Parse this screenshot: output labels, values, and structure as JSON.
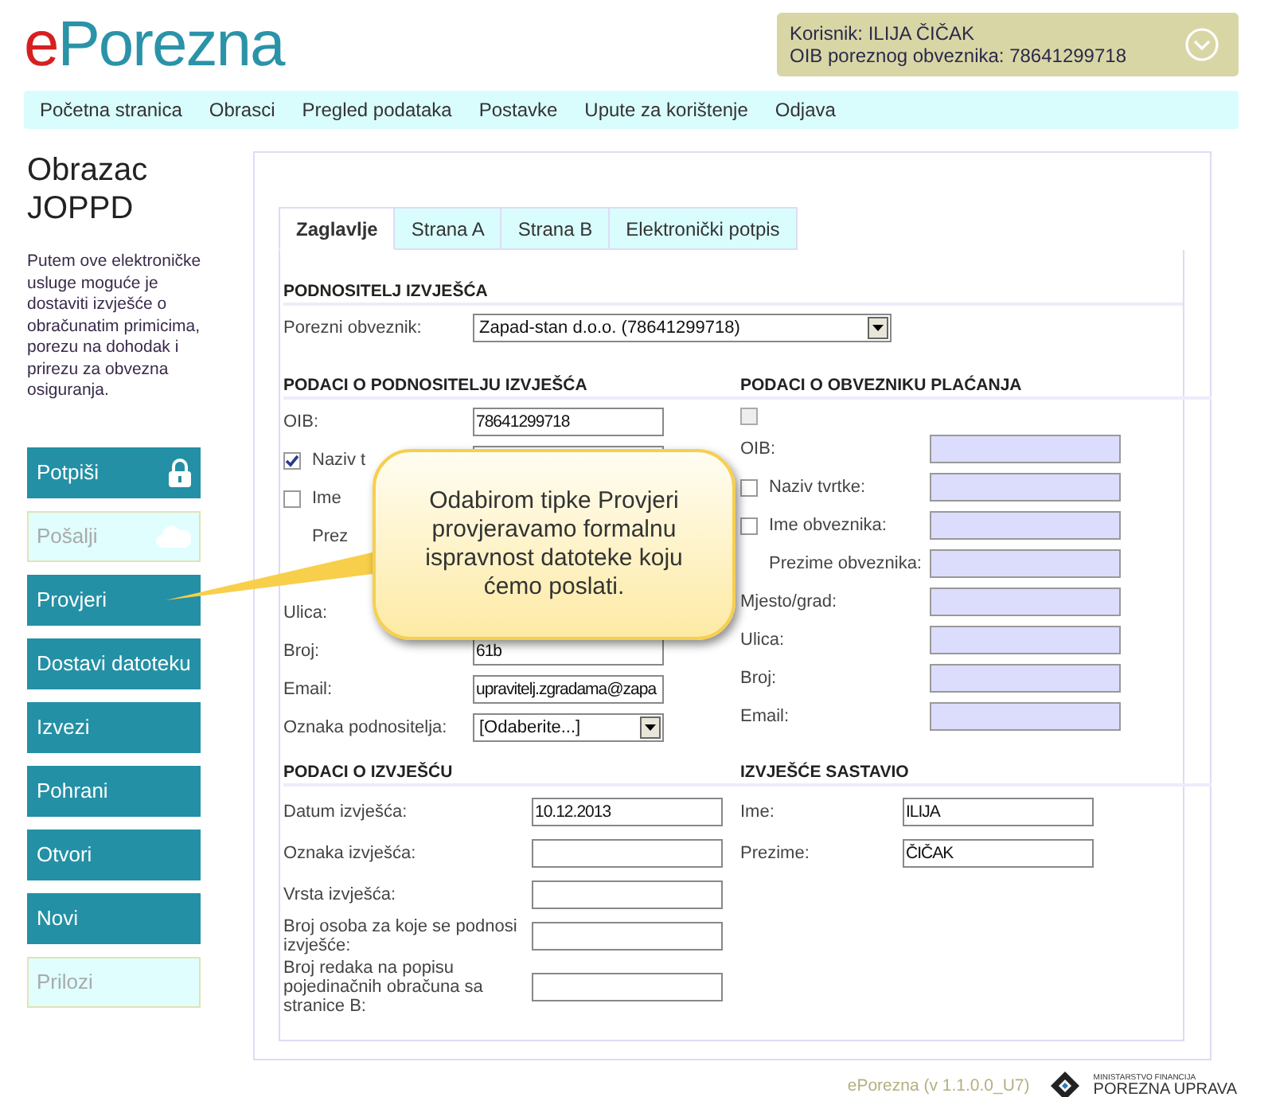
{
  "logo": {
    "prefix": "e",
    "name": "Porezna"
  },
  "user": {
    "line1": "Korisnik: ILIJA ČIČAK",
    "line2": "OIB poreznog obveznika: 78641299718"
  },
  "nav": [
    "Početna stranica",
    "Obrasci",
    "Pregled podataka",
    "Postavke",
    "Upute za korištenje",
    "Odjava"
  ],
  "sidebar": {
    "title": "Obrazac JOPPD",
    "description": "Putem ove elektroničke usluge moguće je dostaviti izvješće o obračunatim primicima, porezu na dohodak i prirezu za obvezna osiguranja.",
    "buttons": [
      {
        "label": "Potpiši",
        "disabled": false
      },
      {
        "label": "Pošalji",
        "disabled": true
      },
      {
        "label": "Provjeri",
        "disabled": false
      },
      {
        "label": "Dostavi datoteku",
        "disabled": false
      },
      {
        "label": "Izvezi",
        "disabled": false
      },
      {
        "label": "Pohrani",
        "disabled": false
      },
      {
        "label": "Otvori",
        "disabled": false
      },
      {
        "label": "Novi",
        "disabled": false
      },
      {
        "label": "Prilozi",
        "disabled": true
      }
    ]
  },
  "tabs": [
    {
      "label": "Zaglavlje",
      "selected": true
    },
    {
      "label": "Strana A",
      "selected": false
    },
    {
      "label": "Strana B",
      "selected": false
    },
    {
      "label": "Elektronički potpis",
      "selected": false
    }
  ],
  "submitter": {
    "heading": "PODNOSITELJ IZVJEŠĆA",
    "label": "Porezni obveznik:",
    "value": "Zapad-stan d.o.o. (78641299718)"
  },
  "submitter_data": {
    "heading": "PODACI O PODNOSITELJU IZVJEŠĆA",
    "rows": [
      {
        "kind": "field",
        "label": "OIB:",
        "value": "78641299718"
      },
      {
        "kind": "check",
        "label": "Naziv t",
        "checked": true
      },
      {
        "kind": "check",
        "label": "Ime",
        "checked": false,
        "field": false
      },
      {
        "kind": "indented",
        "label": "Prez",
        "field": false
      },
      {
        "kind": "covered"
      },
      {
        "kind": "field",
        "label": "Ulica:",
        "field": false
      },
      {
        "kind": "field",
        "label": "Broj:",
        "value": "61b"
      },
      {
        "kind": "field",
        "label": "Email:",
        "value": "upravitelj.zgradama@zapa"
      },
      {
        "kind": "select",
        "label": "Oznaka podnositelja:",
        "value": "[Odaberite...]"
      }
    ]
  },
  "payer_data": {
    "heading": "PODACI O OBVEZNIKU PLAĆANJA",
    "checked": false,
    "rows": [
      {
        "kind": "field",
        "label": "OIB:"
      },
      {
        "kind": "check",
        "label": "Naziv tvrtke:",
        "checked": false
      },
      {
        "kind": "check",
        "label": "Ime obveznika:",
        "checked": false
      },
      {
        "kind": "indented",
        "label": "Prezime obveznika:"
      },
      {
        "kind": "field",
        "label": "Mjesto/grad:"
      },
      {
        "kind": "field",
        "label": "Ulica:"
      },
      {
        "kind": "field",
        "label": "Broj:"
      },
      {
        "kind": "field",
        "label": "Email:"
      }
    ]
  },
  "report": {
    "heading": "PODACI O IZVJEŠĆU",
    "rows": [
      {
        "label": "Datum izvješća:",
        "value": "10.12.2013"
      },
      {
        "label": "Oznaka izvješća:"
      },
      {
        "label": "Vrsta izvješća:"
      },
      {
        "label": "Broj osoba za koje se podnosi izvješće:"
      },
      {
        "label": "Broj redaka na popisu pojedinačnih obračuna sa stranice B:"
      }
    ]
  },
  "author": {
    "heading": "IZVJEŠĆE SASTAVIO",
    "rows": [
      {
        "label": "Ime:",
        "value": "ILIJA"
      },
      {
        "label": "Prezime:",
        "value": "ČIČAK"
      }
    ]
  },
  "callout": {
    "text": "Odabirom tipke Provjeri provjeravamo formalnu ispravnost datoteke koju ćemo poslati."
  },
  "footer": {
    "version": "ePorezna (v 1.1.0.0_U7)",
    "ministry": "MINISTARSTVO FINANCIJA",
    "agency": "POREZNA UPRAVA"
  }
}
